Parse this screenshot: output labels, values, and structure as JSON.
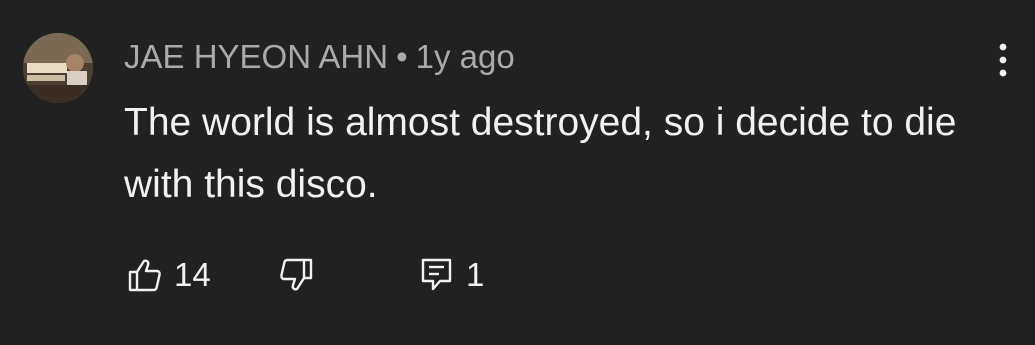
{
  "comment": {
    "author": "JAE HYEON AHN",
    "separator": "•",
    "time": "1y ago",
    "text": "The world is almost destroyed, so i decide to die with this disco.",
    "like_count": "14",
    "reply_count": "1"
  },
  "icons": {
    "menu": "more-vert-icon",
    "like": "thumb-up-icon",
    "dislike": "thumb-down-icon",
    "reply": "reply-icon"
  },
  "colors": {
    "background": "#212121",
    "meta_text": "#aaaaaa",
    "body_text": "#f1f1f1"
  }
}
